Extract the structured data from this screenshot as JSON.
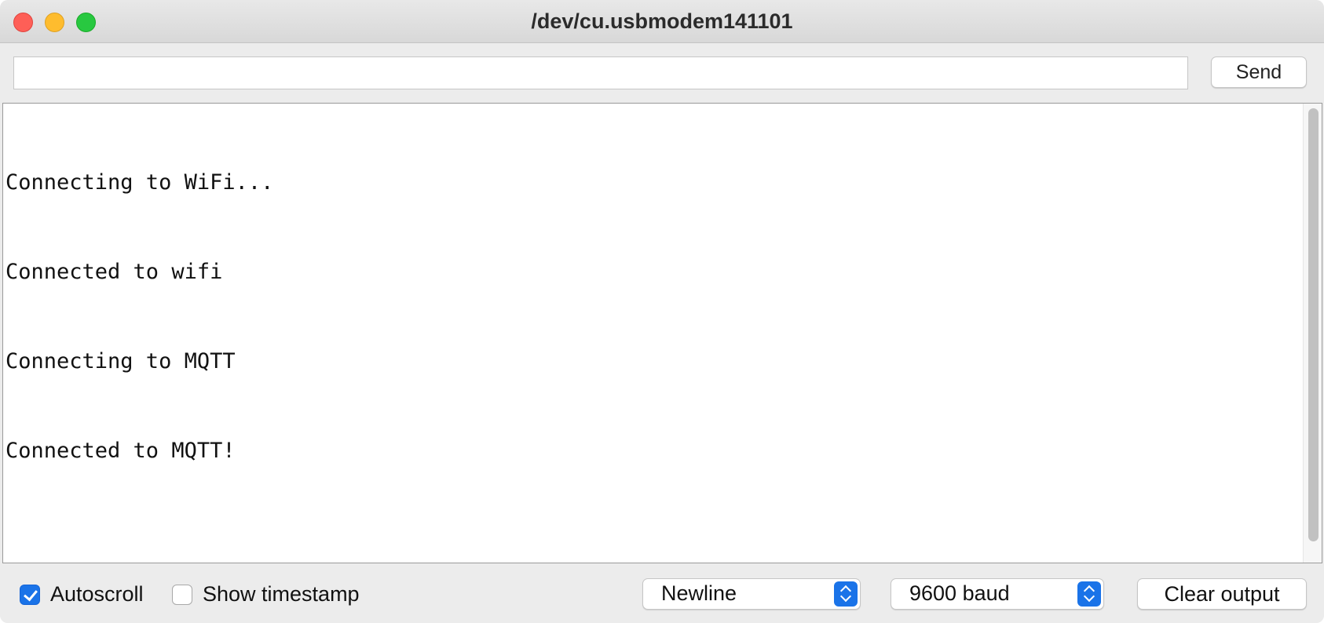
{
  "window": {
    "title": "/dev/cu.usbmodem141101"
  },
  "toolbar": {
    "input_value": "",
    "send_label": "Send"
  },
  "output": {
    "lines": [
      "Connecting to WiFi...",
      "Connected to wifi",
      "Connecting to MQTT",
      "Connected to MQTT!"
    ]
  },
  "bottombar": {
    "autoscroll": {
      "label": "Autoscroll",
      "checked": true
    },
    "timestamp": {
      "label": "Show timestamp",
      "checked": false
    },
    "line_ending": {
      "selected": "Newline"
    },
    "baud_rate": {
      "selected": "9600 baud"
    },
    "clear_label": "Clear output"
  },
  "colors": {
    "accent": "#1a73e8",
    "close": "#fe5f57",
    "minimize": "#febc2e",
    "maximize": "#28c840"
  },
  "icons": {
    "close": "close-icon",
    "minimize": "minimize-icon",
    "maximize": "maximize-icon",
    "checkmark": "checkmark-icon",
    "stepper": "up-down-chevron-icon"
  }
}
